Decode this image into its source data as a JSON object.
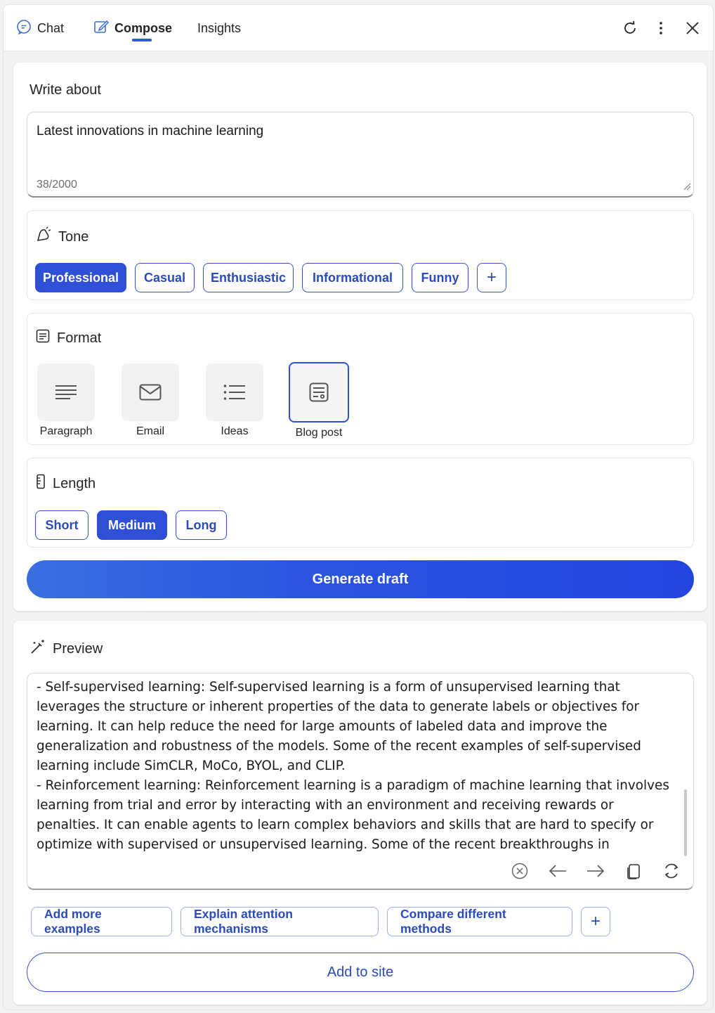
{
  "tabs": [
    {
      "label": "Chat",
      "icon": "chat-icon"
    },
    {
      "label": "Compose",
      "icon": "compose-icon",
      "active": true
    },
    {
      "label": "Insights",
      "icon": ""
    }
  ],
  "top_actions": [
    "refresh-icon",
    "more-icon",
    "close-icon"
  ],
  "compose": {
    "write_about_label": "Write about",
    "input_value": "Latest innovations in machine learning",
    "char_count": "38/2000",
    "tone": {
      "title": "Tone",
      "options": [
        "Professional",
        "Casual",
        "Enthusiastic",
        "Informational",
        "Funny"
      ],
      "selected": "Professional",
      "add_label": "+"
    },
    "format": {
      "title": "Format",
      "options": [
        {
          "label": "Paragraph",
          "icon": "paragraph-icon"
        },
        {
          "label": "Email",
          "icon": "email-icon"
        },
        {
          "label": "Ideas",
          "icon": "list-icon"
        },
        {
          "label": "Blog post",
          "icon": "blog-post-icon"
        }
      ],
      "selected": "Blog post"
    },
    "length": {
      "title": "Length",
      "options": [
        "Short",
        "Medium",
        "Long"
      ],
      "selected": "Medium"
    },
    "generate_label": "Generate draft"
  },
  "preview": {
    "title": "Preview",
    "text": "- Self-supervised learning: Self-supervised learning is a form of unsupervised learning that leverages the structure or inherent properties of the data to generate labels or objectives for learning. It can help reduce the need for large amounts of labeled data and improve the generalization and robustness of the models. Some of the recent examples of self-supervised learning include SimCLR, MoCo, BYOL, and CLIP.\n- Reinforcement learning: Reinforcement learning is a paradigm of machine learning that involves learning from trial and error by interacting with an environment and receiving rewards or penalties. It can enable agents to learn complex behaviors and skills that are hard to specify or optimize with supervised or unsupervised learning. Some of the recent breakthroughs in",
    "tools": [
      "stop-icon",
      "back-arrow-icon",
      "forward-arrow-icon",
      "copy-icon",
      "regenerate-icon"
    ],
    "suggestions": [
      "Add more examples",
      "Explain attention mechanisms",
      "Compare different methods"
    ],
    "add_suggestion_label": "+",
    "add_to_site_label": "Add to site"
  },
  "colors": {
    "accent": "#2f4fd6",
    "accent_text": "#2b4bb8"
  }
}
